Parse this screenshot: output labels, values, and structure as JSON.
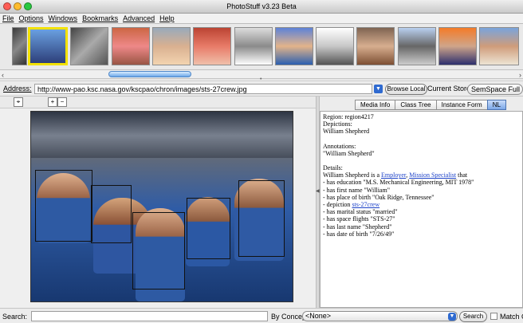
{
  "window": {
    "title": "PhotoStuff v3.23 Beta"
  },
  "menu": {
    "items": [
      "File",
      "Options",
      "Windows",
      "Bookmarks",
      "Advanced",
      "Help"
    ]
  },
  "address": {
    "label": "Address:",
    "value": "http://www-pao.ksc.nasa.gov/kscpao/chron/images/sts-27crew.jpg",
    "browse_label": "Browse Local",
    "store_label": "Current Store:",
    "store_value": "SemSpace Full Site"
  },
  "tabs": [
    {
      "label": "Media Info"
    },
    {
      "label": "Class Tree"
    },
    {
      "label": "Instance Form"
    },
    {
      "label": "NL",
      "active": true
    }
  ],
  "nl": {
    "region": "Region: region4217",
    "depictions_label": "Depictions:",
    "depictions_value": "William Shepherd",
    "annotations_label": "Annotations:",
    "annotations_value": "\"William Shepherd\"",
    "details_label": "Details:",
    "details_prefix": "William Shepherd is a",
    "details_link1": "Employer",
    "details_link2": "Mission Specialist",
    "details_suffix": "that",
    "line_education": "- has education \"M.S. Mechanical Engineering, MIT 1978\"",
    "line_first": "- has first name \"William\"",
    "line_birthplace": "- has place of birth \"Oak Ridge, Tennessee\"",
    "line_depiction_prefix": "- depiction",
    "line_depiction_link": "sts-27crew",
    "line_marital": "- has marital status \"married\"",
    "line_flights": "- has space flights \"STS-27\"",
    "line_last": "- has last name \"Shepherd\"",
    "line_dob": "- has date of birth \"7/26/49\""
  },
  "bottom": {
    "search_label": "Search:",
    "concept_label": "By Concept:",
    "concept_value": "<None>",
    "search_button": "Search",
    "match_label": "Match Ca"
  },
  "icons": {
    "zoom_in": "zoom-in-icon",
    "zoom_out": "zoom-out-icon",
    "select": "select-tool-icon"
  },
  "colors": {
    "selected_thumb": "#f2e100",
    "active_tab": "#7ca8e8",
    "link": "#1d42c8"
  }
}
